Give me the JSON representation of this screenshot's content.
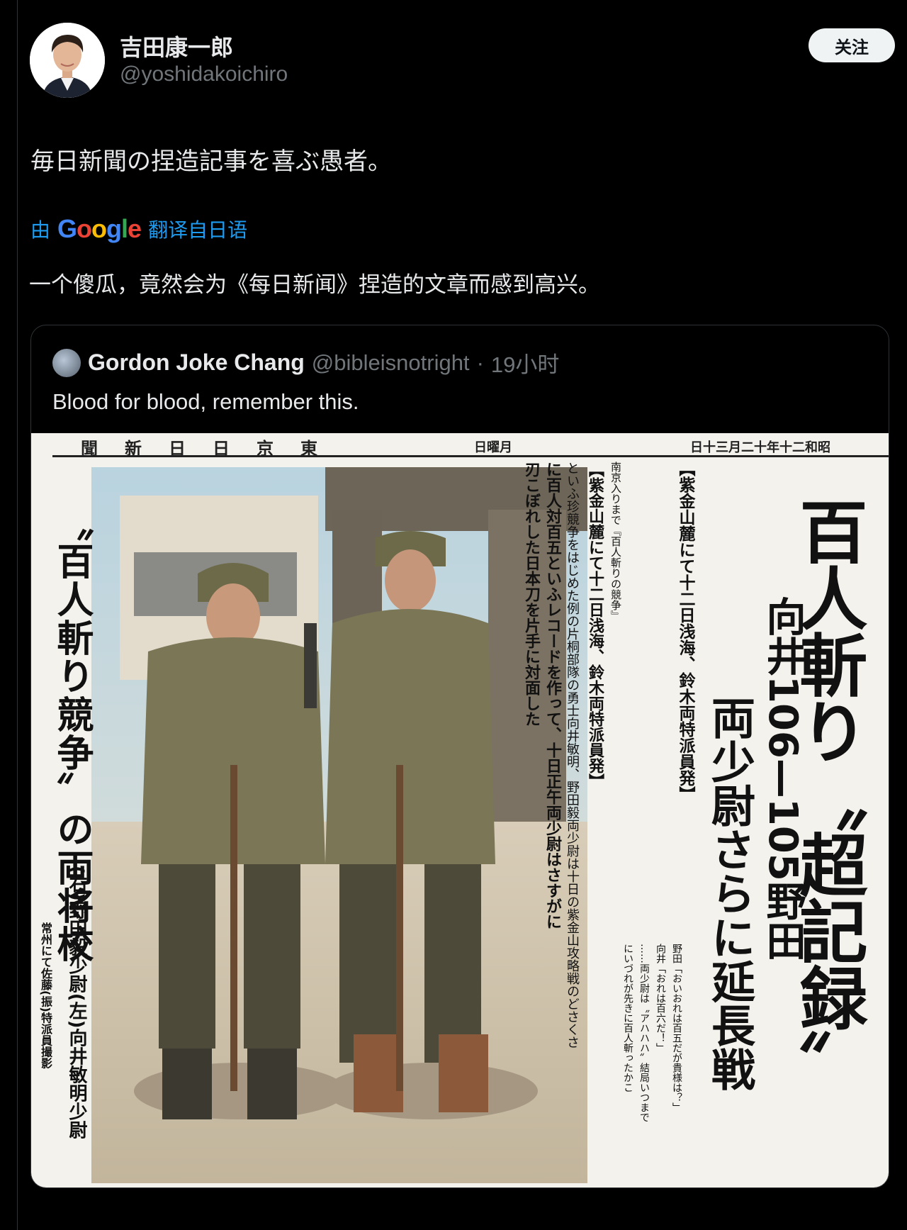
{
  "author": {
    "display_name": "吉田康一郎",
    "handle": "@yoshidakoichiro",
    "follow_label": "关注"
  },
  "tweet": {
    "text": "毎日新聞の捏造記事を喜ぶ愚者。",
    "translate_prefix": "由",
    "translate_brand": "Google",
    "translate_suffix": "翻译自日语",
    "translated_text": "一个傻瓜，竟然会为《每日新闻》捏造的文章而感到高兴。"
  },
  "quote": {
    "name": "Gordon Joke Chang",
    "handle": "@bibleisnotright",
    "separator": "·",
    "time": "19小时",
    "text": "Blood for blood, remember this."
  },
  "newspaper": {
    "masthead": "聞新日日京東",
    "day": "日曜月",
    "date": "日十三月二十年十二和昭",
    "headline": "百人斬り〝超記録〟",
    "score": "向井106—105野田",
    "subheadline": "両少尉さらに延長戦",
    "left_caption": "〝百人斬り競争〟の両将校",
    "left_sub": "(右)野田毅少尉(左)向井敏明少尉",
    "credit": "常州にて佐藤(振)特派員撮影",
    "body_lines": [
      "【紫金山麓にて十二日浅海、鈴木両特派員発】",
      "南京入りまで『百人斬りの競争』",
      "といふ珍競争をはじめた例の片桐部隊の勇士向井敏明、野田毅両少尉は十日の紫金山攻略戦のどさくさ",
      "に百人対百五といふレコードを作って、十日正午両少尉はさすがに",
      "刃こぼれした日本刀を片手に対面した"
    ],
    "body_lines2": [
      "野田「おいおれは百五だが貴様は？」",
      "向井「おれは百六だ！」",
      "……両少尉は〝アハハハ〟結局いつまで",
      "にいづれが先きに百人斬ったかこ"
    ]
  }
}
